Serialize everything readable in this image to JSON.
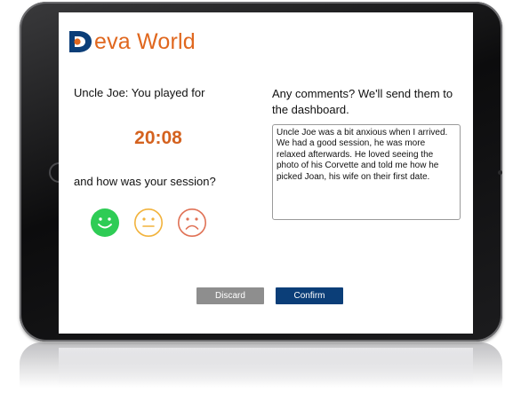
{
  "app": {
    "logo_text": "eva World",
    "logo_letter": "D"
  },
  "session": {
    "played_label": "Uncle Joe: You played for",
    "duration": "20:08",
    "rating_question": "and how was your session?",
    "ratings": [
      {
        "icon": "happy-face-icon",
        "color": "#2ecc55"
      },
      {
        "icon": "neutral-face-icon",
        "color": "#f2b33d"
      },
      {
        "icon": "sad-face-icon",
        "color": "#e07256"
      }
    ]
  },
  "comments": {
    "label": "Any comments? We'll send them to the dashboard.",
    "value": "Uncle Joe was a bit anxious when I arrived. We had a good session, he was more relaxed afterwards. He loved seeing the photo of his Corvette and told me how he picked Joan, his wife on their first date."
  },
  "actions": {
    "discard_label": "Discard",
    "confirm_label": "Confirm"
  },
  "colors": {
    "brand_orange": "#e0671e",
    "brand_navy": "#0b3e78",
    "timer": "#d4621f"
  }
}
